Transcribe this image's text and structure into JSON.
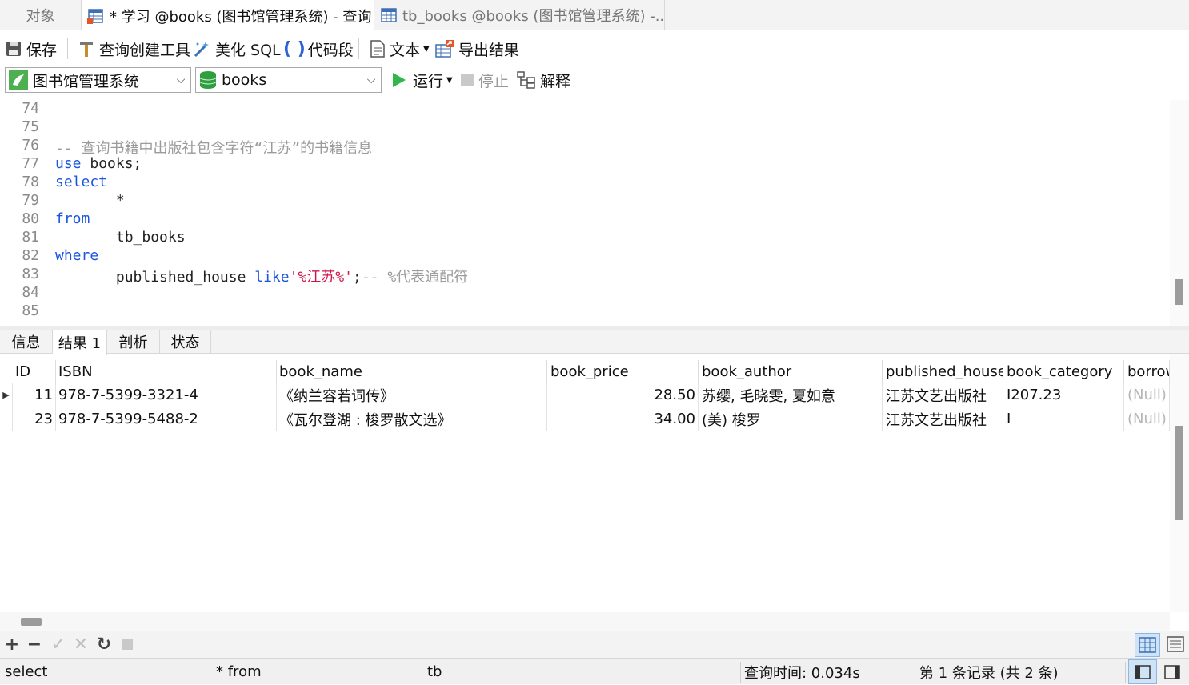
{
  "tabs": {
    "objects": "对象",
    "query": "* 学习 @books (图书馆管理系统) - 查询",
    "table": "tb_books @books (图书馆管理系统) -..."
  },
  "toolbar": {
    "save": "保存",
    "query_builder": "查询创建工具",
    "beautify_sql": "美化 SQL",
    "snippet": "代码段",
    "text": "文本",
    "export": "导出结果",
    "connection": "图书馆管理系统",
    "database": "books",
    "run": "运行",
    "stop": "停止",
    "explain": "解释"
  },
  "editor": {
    "lines": [
      {
        "n": "74"
      },
      {
        "n": "75"
      },
      {
        "n": "76",
        "comment": "-- 查询书籍中出版社包含字符“江苏”的书籍信息"
      },
      {
        "n": "77",
        "kw": "use",
        "text": " books;"
      },
      {
        "n": "78",
        "kw": "select"
      },
      {
        "n": "79",
        "text": "       *"
      },
      {
        "n": "80",
        "kw": "from"
      },
      {
        "n": "81",
        "text": "       tb_books"
      },
      {
        "n": "82",
        "kw": "where"
      },
      {
        "n": "83",
        "text": "       published_house ",
        "kw2": "like",
        "str": "'%江苏%'",
        "text2": ";",
        "comment": "-- %代表通配符"
      },
      {
        "n": "84"
      },
      {
        "n": "85"
      }
    ]
  },
  "result_tabs": [
    "信息",
    "结果 1",
    "剖析",
    "状态"
  ],
  "grid": {
    "columns": [
      "ID",
      "ISBN",
      "book_name",
      "book_price",
      "book_author",
      "published_house",
      "book_category",
      "borrow"
    ],
    "rows": [
      [
        "11",
        "978-7-5399-3321-4",
        "《纳兰容若词传》",
        "28.50",
        "苏缨, 毛晓雯, 夏如意",
        "江苏文艺出版社",
        "I207.23",
        "(Null)"
      ],
      [
        "23",
        "978-7-5399-5488-2",
        "《瓦尔登湖 : 梭罗散文选》",
        "34.00",
        "(美) 梭罗",
        "江苏文艺出版社",
        "I",
        "(Null)"
      ]
    ]
  },
  "status": {
    "sql1": "select",
    "sql2": "*  from",
    "sql3": "tb",
    "query_time": "查询时间: 0.034s",
    "record": "第 1 条记录  (共 2 条)"
  }
}
